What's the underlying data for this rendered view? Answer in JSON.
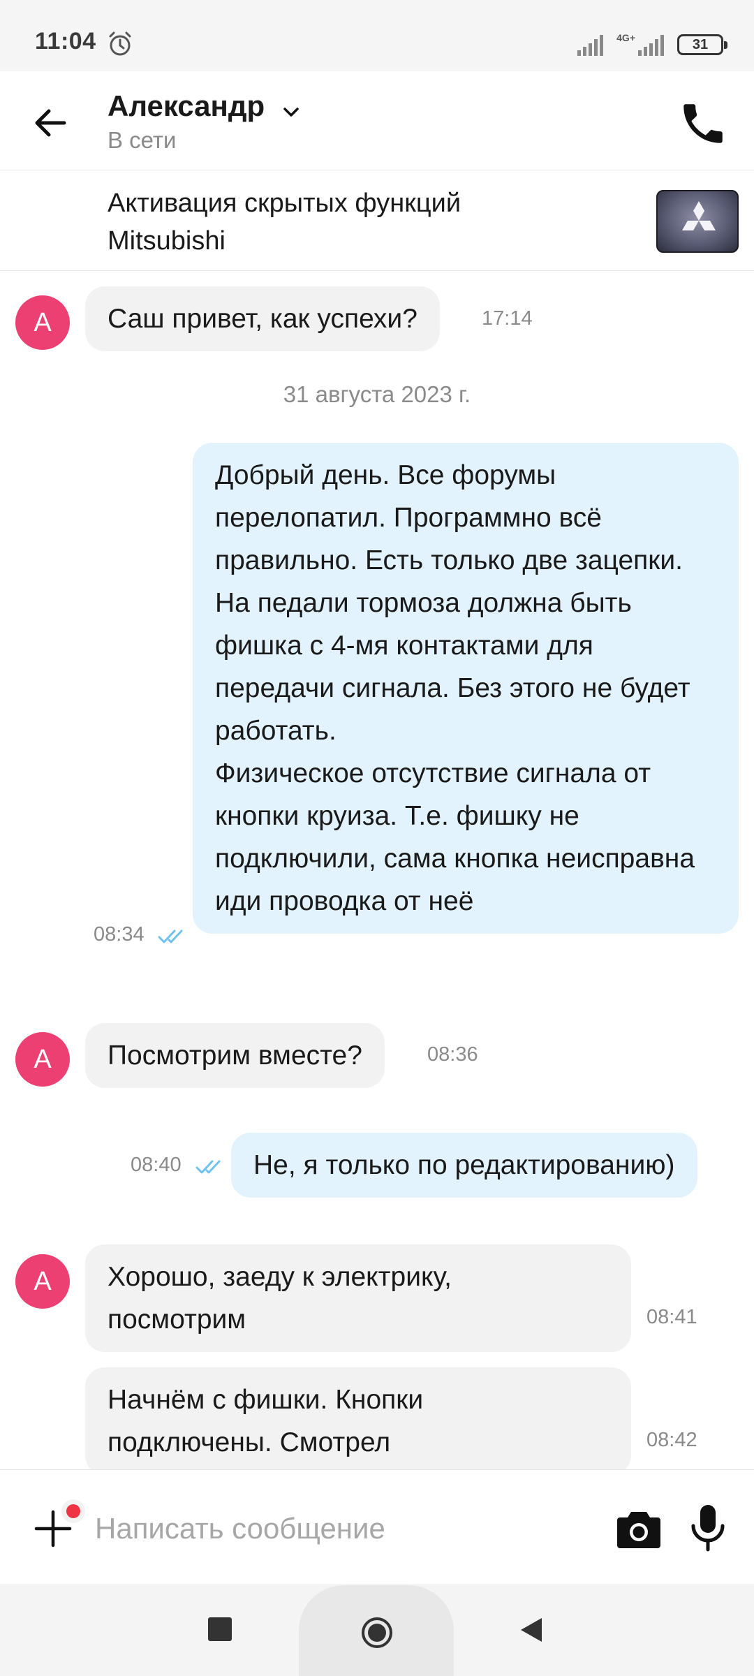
{
  "status_bar": {
    "time": "11:04",
    "network": "4G+",
    "battery": "31"
  },
  "header": {
    "contact_name": "Александр",
    "contact_status": "В сети"
  },
  "listing": {
    "title": "Активация скрытых функций Mitsubishi"
  },
  "chat": {
    "avatar_letter": "А",
    "date_separator": "31 августа 2023 г.",
    "messages": [
      {
        "direction": "in",
        "text": "Саш привет, как успехи?",
        "time": "17:14"
      },
      {
        "direction": "out",
        "text": "Добрый день. Все форумы перелопатил. Программно всё правильно. Есть только две зацепки.\nНа педали тормоза должна быть фишка с 4-мя контактами для передачи сигнала. Без этого не будет работать.\nФизическое отсутствие сигнала от кнопки круиза. Т.е. фишку не подключили, сама кнопка неисправна иди проводка от неё",
        "time": "08:34",
        "status": "read"
      },
      {
        "direction": "in",
        "text": "Посмотрим вместе?",
        "time": "08:36"
      },
      {
        "direction": "out",
        "text": "Не, я только по редактированию)",
        "time": "08:40",
        "status": "read"
      },
      {
        "direction": "in",
        "text": "Хорошо, заеду к электрику, посмотрим",
        "time": "08:41"
      },
      {
        "direction": "in",
        "text": "Начнём с фишки. Кнопки подключены. Смотрел",
        "time": "08:42"
      }
    ]
  },
  "composer": {
    "placeholder": "Написать сообщение"
  },
  "icons": {
    "back": "arrow-left-icon",
    "call": "phone-icon",
    "attach": "plus-icon",
    "camera": "camera-icon",
    "mic": "microphone-icon",
    "read_receipt": "double-check-icon"
  },
  "colors": {
    "avatar": "#ec3f72",
    "incoming_bubble": "#f2f2f2",
    "outgoing_bubble": "#e3f3fd",
    "read_ticks": "#6ec3ee",
    "badge": "#ee3344"
  }
}
